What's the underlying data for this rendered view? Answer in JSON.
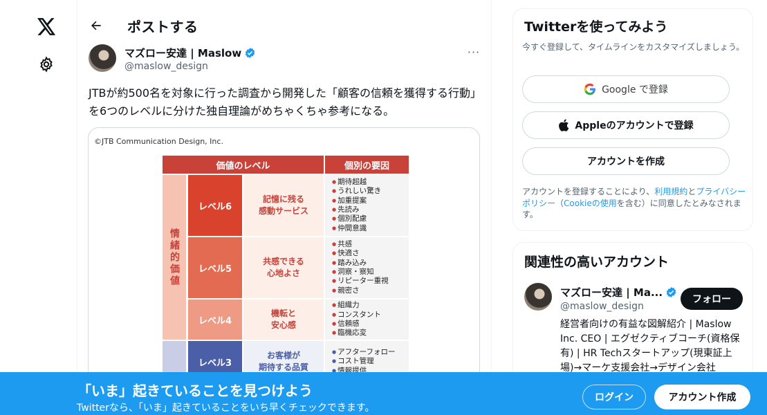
{
  "nav": {
    "logo_icon": "x-logo-icon",
    "settings_icon": "gear-icon"
  },
  "header": {
    "back_icon": "arrow-left-icon",
    "title": "ポストする"
  },
  "post": {
    "author_name": "マズロー安達 | Maslow",
    "author_handle": "@maslow_design",
    "more_label": "···",
    "text": "JTBが約500名を対象に行った調査から開発した「顧客の信頼を獲得する行動」を6つのレベルに分けた独自理論がめちゃくちゃ参考になる。",
    "image": {
      "copyright": "©JTB Communication Design, Inc.",
      "header_left": "価値のレベル",
      "header_right": "個別の要因",
      "group_emotional": "情緒的価値",
      "levels": [
        {
          "label": "レベル6",
          "desc_line1": "記憶に残る",
          "desc_line2": "感動サービス",
          "factors": [
            "期待超越",
            "うれしい驚き",
            "加重提案",
            "先読み",
            "個別配慮",
            "仲間意識"
          ]
        },
        {
          "label": "レベル5",
          "desc_line1": "共感できる",
          "desc_line2": "心地よさ",
          "factors": [
            "共感",
            "快適さ",
            "踏み込み",
            "洞察・察知",
            "リピーター重視",
            "親密さ"
          ]
        },
        {
          "label": "レベル4",
          "desc_line1": "機転と",
          "desc_line2": "安心感",
          "factors": [
            "組織力",
            "コンスタント",
            "信頼感",
            "臨機応変"
          ]
        },
        {
          "label": "レベル3",
          "desc_line1": "お客様が",
          "desc_line2": "期待する品質",
          "factors": [
            "アフターフォロー",
            "コスト管理",
            "情報提供"
          ]
        }
      ]
    }
  },
  "signup_card": {
    "title": "Twitterを使ってみよう",
    "subtitle": "今すぐ登録して、タイムラインをカスタマイズしましょう。",
    "google_label": "Google で登録",
    "apple_label": "Appleのアカウントで登録",
    "create_label": "アカウントを作成",
    "legal_prefix": "アカウントを登録することにより、",
    "legal_terms": "利用規約",
    "legal_and": "と",
    "legal_privacy": "プライバシーポリシー",
    "legal_paren_open": "（",
    "legal_cookie": "Cookieの使用",
    "legal_paren_close": "を含む）に同意したとみなされます。"
  },
  "related": {
    "title": "関連性の高いアカウント",
    "name": "マズロー安達 | Ma...",
    "handle": "@maslow_design",
    "follow_label": "フォロー",
    "bio": "経営者向けの有益な図解紹介 | Maslow Inc. CEO | エグゼクティブコーチ(資格保有) | HR Techスタートアップ(現東証上場)→マーケ支援会社→デザイン会社"
  },
  "banner": {
    "title": "「いま」起きていることを見つけよう",
    "subtitle": "Twitterなら、「いま」起きていることをいち早くチェックできます。",
    "login_label": "ログイン",
    "signup_label": "アカウント作成"
  },
  "colors": {
    "accent": "#1d9bf0",
    "verified": "#1d9bf0",
    "chart_red": "#c8423a",
    "chart_blue": "#4a5fa8"
  }
}
